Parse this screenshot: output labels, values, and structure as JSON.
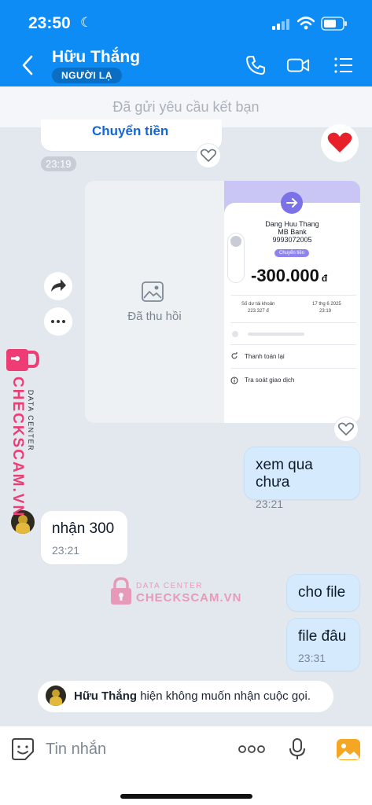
{
  "status": {
    "time": "23:50"
  },
  "header": {
    "name": "Hữu Thắng",
    "tag": "NGƯỜI LẠ"
  },
  "banner": {
    "text": "Đã gửi yêu cầu kết bạn"
  },
  "messages": {
    "partial": {
      "text": "Chuyển tiền",
      "time": "23:19"
    },
    "revoked": {
      "text": "Đã thu hồi"
    },
    "receipt": {
      "name": "Dang Huu Thang",
      "bank": "MB Bank",
      "account": "9993072005",
      "badge": "Chuyển tiền",
      "amount": "-300.000",
      "currency": "đ",
      "balance_label": "Số dư tài khoản",
      "balance_value": "223.327 đ",
      "date": "17 thg 6 2025",
      "time": "23:19",
      "action1": "Thanh toán lại",
      "action2": "Tra soát giao dịch"
    },
    "m1": {
      "text": "xem qua chưa",
      "time": "23:21"
    },
    "m2": {
      "text": "nhận 300",
      "time": "23:21"
    },
    "m3": {
      "text": "cho file"
    },
    "m4": {
      "text": "file đâu",
      "time": "23:31"
    }
  },
  "call_notice": {
    "name": "Hữu Thắng",
    "text": " hiện không muốn nhận cuộc gọi."
  },
  "composer": {
    "placeholder": "Tin nhắn"
  },
  "watermark": {
    "label": "DATA CENTER",
    "brand": "CHECKSCAM.VN"
  },
  "colors": {
    "accent": "#0d8cf5",
    "my_bubble": "#d5ebfd",
    "watermark": "#ee3d75"
  }
}
